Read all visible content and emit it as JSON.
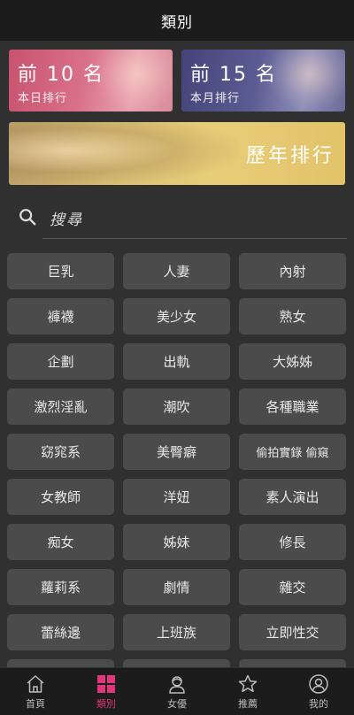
{
  "header": {
    "title": "類別"
  },
  "banners": {
    "daily": {
      "title": "前 10 名",
      "subtitle": "本日排行"
    },
    "monthly": {
      "title": "前 15 名",
      "subtitle": "本月排行"
    },
    "yearly": {
      "title": "歷年排行"
    }
  },
  "search": {
    "placeholder": "搜尋"
  },
  "categories": [
    "巨乳",
    "人妻",
    "內射",
    "褲襪",
    "美少女",
    "熟女",
    "企劃",
    "出軌",
    "大姊姊",
    "激烈淫亂",
    "潮吹",
    "各種職業",
    "窈窕系",
    "美臀癖",
    "偷拍實錄 偷窺",
    "女教師",
    "洋妞",
    "素人演出",
    "痴女",
    "姊妹",
    "修長",
    "蘿莉系",
    "劇情",
    "雜交",
    "蕾絲邊",
    "上班族",
    "立即性交"
  ],
  "tabs": [
    {
      "label": "首頁",
      "icon": "home-icon"
    },
    {
      "label": "類別",
      "icon": "grid-icon"
    },
    {
      "label": "女優",
      "icon": "actress-icon"
    },
    {
      "label": "推薦",
      "icon": "star-icon"
    },
    {
      "label": "我的",
      "icon": "profile-icon"
    }
  ],
  "colors": {
    "accent": "#e0357a",
    "background": "#303030",
    "button": "#4b4b4b"
  }
}
